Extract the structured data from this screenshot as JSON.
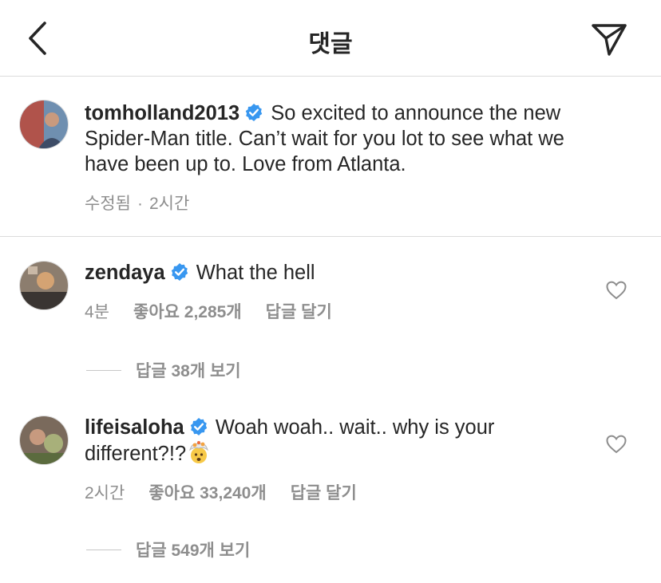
{
  "header": {
    "title": "댓글",
    "back_icon": "chevron-left-icon",
    "share_icon": "paper-plane-icon"
  },
  "post": {
    "username": "tomholland2013",
    "caption_lines": [
      "So excited to announce the new",
      "Spider-Man title. Can’t wait for you lot to see what we",
      "have been up to. Love from Atlanta."
    ],
    "edited": "수정됨",
    "separator": "·",
    "time": "2시간"
  },
  "comments": [
    {
      "username": "zendaya",
      "text_lines": [
        "What the hell"
      ],
      "time": "4분",
      "likes": "좋아요 2,285개",
      "reply": "답글 달기",
      "view_replies": "답글 38개 보기"
    },
    {
      "username": "lifeisaloha",
      "text_lines": [
        "Woah woah.. wait.. why is your",
        "different?!?"
      ],
      "emoji": "exploding-head-emoji",
      "time": "2시간",
      "likes": "좋아요 33,240개",
      "reply": "답글 달기",
      "view_replies": "답글 549개 보기"
    }
  ],
  "colors": {
    "verified_blue": "#3897f0",
    "secondary_text": "#8e8e8e",
    "divider": "#dbdbdb"
  }
}
